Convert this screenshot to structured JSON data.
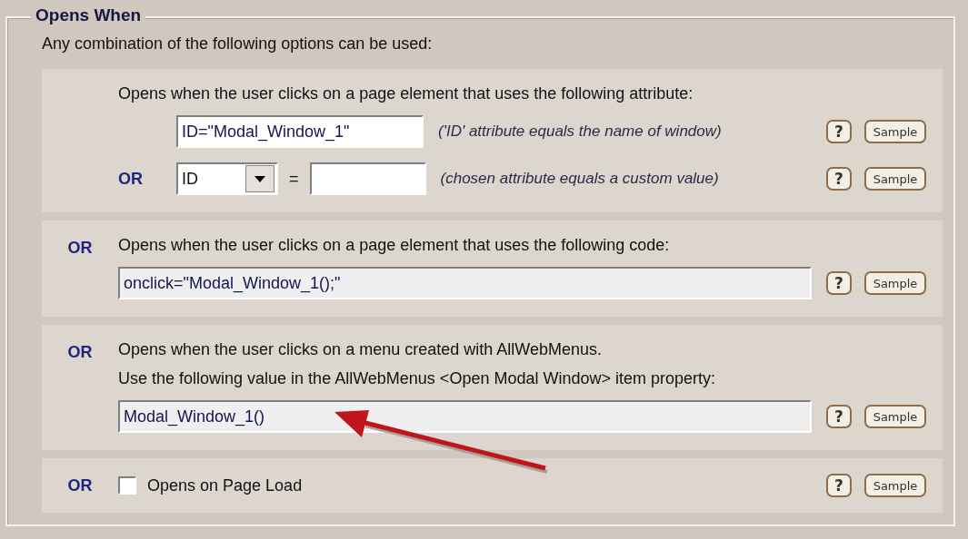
{
  "legend": "Opens When",
  "intro": "Any combination of the following options can be used:",
  "panels": [
    {
      "kind": "fields",
      "lines": [
        "Opens when the user clicks on a page element that uses the following attribute:"
      ],
      "rows": [
        {
          "kind": "input",
          "value": "ID=\"Modal_Window_1\"",
          "hint": "('ID' attribute equals the name of window)",
          "help": "?",
          "sample": "Sample"
        },
        {
          "kind": "select",
          "or": "OR",
          "select": "ID",
          "equals": "=",
          "hint": "(chosen attribute equals a custom value)",
          "help": "?",
          "sample": "Sample"
        }
      ]
    },
    {
      "kind": "fields",
      "or": "OR",
      "lines": [
        "Opens when the user clicks on a page element that uses the following code:"
      ],
      "rows": [
        {
          "kind": "wide",
          "value": "onclick=\"Modal_Window_1();\"",
          "help": "?",
          "sample": "Sample"
        }
      ]
    },
    {
      "kind": "fields",
      "or": "OR",
      "arrow": true,
      "lines": [
        "Opens when the user clicks on a menu created with AllWebMenus.",
        "Use the following value in the AllWebMenus <Open Modal Window> item property:"
      ],
      "rows": [
        {
          "kind": "wide",
          "value": "Modal_Window_1()",
          "help": "?",
          "sample": "Sample"
        }
      ]
    },
    {
      "kind": "checkbox",
      "or": "OR",
      "label": "Opens on Page Load",
      "checked": false,
      "help": "?",
      "sample": "Sample"
    }
  ]
}
